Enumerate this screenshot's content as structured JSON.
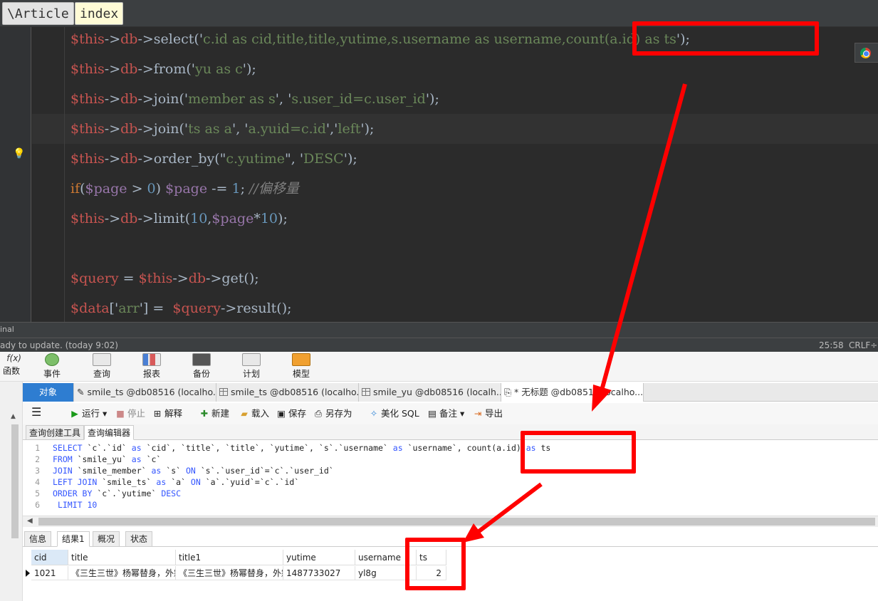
{
  "ide": {
    "breadcrumbs": [
      "\\Article",
      "index"
    ],
    "code_lines": [
      [
        [
          "v",
          "$this"
        ],
        [
          "p",
          "->"
        ],
        [
          "v",
          "db"
        ],
        [
          "p",
          "->select('"
        ],
        [
          "s",
          "c.id as cid,title,title,yutime,s.username as username,count(a.id) as ts"
        ],
        [
          "p",
          "');"
        ]
      ],
      [
        [
          "v",
          "$this"
        ],
        [
          "p",
          "->"
        ],
        [
          "v",
          "db"
        ],
        [
          "p",
          "->from('"
        ],
        [
          "s",
          "yu as c"
        ],
        [
          "p",
          "');"
        ]
      ],
      [
        [
          "v",
          "$this"
        ],
        [
          "p",
          "->"
        ],
        [
          "v",
          "db"
        ],
        [
          "p",
          "->join('"
        ],
        [
          "s",
          "member as s"
        ],
        [
          "p",
          "', '"
        ],
        [
          "s",
          "s.user_id=c.user_id"
        ],
        [
          "p",
          "');"
        ]
      ],
      [
        [
          "v",
          "$this"
        ],
        [
          "p",
          "->"
        ],
        [
          "v",
          "db"
        ],
        [
          "p",
          "->join('"
        ],
        [
          "s",
          "ts as a"
        ],
        [
          "p",
          "', '"
        ],
        [
          "s",
          "a.yuid=c.id"
        ],
        [
          "p",
          "','"
        ],
        [
          "s",
          "left"
        ],
        [
          "p",
          "');"
        ]
      ],
      [
        [
          "v",
          "$this"
        ],
        [
          "p",
          "->"
        ],
        [
          "v",
          "db"
        ],
        [
          "p",
          "->order_by(\""
        ],
        [
          "s",
          "c.yutime"
        ],
        [
          "p",
          "\", '"
        ],
        [
          "s",
          "DESC"
        ],
        [
          "p",
          "');"
        ]
      ],
      [
        [
          "kw",
          "if"
        ],
        [
          "p",
          "("
        ],
        [
          "pv",
          "$page"
        ],
        [
          "p",
          " > "
        ],
        [
          "n",
          "0"
        ],
        [
          "p",
          ") "
        ],
        [
          "pv",
          "$page"
        ],
        [
          "p",
          " -= "
        ],
        [
          "n",
          "1"
        ],
        [
          "p",
          "; "
        ],
        [
          "cm",
          "//偏移量"
        ]
      ],
      [
        [
          "v",
          "$this"
        ],
        [
          "p",
          "->"
        ],
        [
          "v",
          "db"
        ],
        [
          "p",
          "->limit("
        ],
        [
          "n",
          "10"
        ],
        [
          "p",
          ","
        ],
        [
          "pv",
          "$page"
        ],
        [
          "p",
          "*"
        ],
        [
          "n",
          "10"
        ],
        [
          "p",
          ");"
        ]
      ],
      [],
      [
        [
          "v",
          "$query"
        ],
        [
          "p",
          " = "
        ],
        [
          "v",
          "$this"
        ],
        [
          "p",
          "->"
        ],
        [
          "v",
          "db"
        ],
        [
          "p",
          "->get();"
        ]
      ],
      [
        [
          "v",
          "$data"
        ],
        [
          "p",
          "['"
        ],
        [
          "s",
          "arr"
        ],
        [
          "p",
          "'] =  "
        ],
        [
          "v",
          "$query"
        ],
        [
          "p",
          "->result();"
        ]
      ]
    ],
    "terminal_label": "inal",
    "status_message": "ady to update. (today 9:02)",
    "cursor_position": "25:58",
    "line_ending": "CRLF÷"
  },
  "navicat": {
    "main_toolbar": [
      "函数",
      "事件",
      "查询",
      "报表",
      "备份",
      "计划",
      "模型"
    ],
    "function_icon_label": "f(x)",
    "doc_tabs": [
      {
        "label": "对象",
        "kind": "objects"
      },
      {
        "label": "smile_ts @db08516 (localho...",
        "kind": "design"
      },
      {
        "label": "smile_ts @db08516 (localho...",
        "kind": "table"
      },
      {
        "label": "smile_yu @db08516 (localh...",
        "kind": "table"
      },
      {
        "label": "* 无标题 @db08516(localho...",
        "kind": "query"
      }
    ],
    "query_toolbar": {
      "menu": "☰",
      "run": "运行",
      "stop": "停止",
      "explain": "解释",
      "new": "新建",
      "load": "载入",
      "save": "保存",
      "save_as": "另存为",
      "beautify": "美化 SQL",
      "comment": "备注",
      "export": "导出"
    },
    "sub_tabs": [
      "查询创建工具",
      "查询编辑器"
    ],
    "sql_lines": [
      [
        [
          "sp",
          "SELECT"
        ],
        [
          "t",
          " `c`.`id` "
        ],
        [
          "sp",
          "as"
        ],
        [
          "t",
          " `cid`, `title`, `title`, `yutime`, `s`.`username` "
        ],
        [
          "sp",
          "as"
        ],
        [
          "t",
          " `username`, count(a.id) "
        ],
        [
          "sp",
          "as"
        ],
        [
          "t",
          " ts"
        ]
      ],
      [
        [
          "sp",
          "FROM"
        ],
        [
          "t",
          " `smile_yu` "
        ],
        [
          "sp",
          "as"
        ],
        [
          "t",
          " `c`"
        ]
      ],
      [
        [
          "sp",
          "JOIN"
        ],
        [
          "t",
          " `smile_member` "
        ],
        [
          "sp",
          "as"
        ],
        [
          "t",
          " `s` "
        ],
        [
          "sp",
          "ON"
        ],
        [
          "t",
          " `s`.`user_id`=`c`.`user_id`"
        ]
      ],
      [
        [
          "sp",
          "LEFT JOIN"
        ],
        [
          "t",
          " `smile_ts` "
        ],
        [
          "sp",
          "as"
        ],
        [
          "t",
          " `a` "
        ],
        [
          "sp",
          "ON"
        ],
        [
          "t",
          " `a`.`yuid`=`c`.`id`"
        ]
      ],
      [
        [
          "sp",
          "ORDER BY"
        ],
        [
          "t",
          " `c`.`yutime` "
        ],
        [
          "sp",
          "DESC"
        ]
      ],
      [
        [
          "t",
          " "
        ],
        [
          "sp",
          "LIMIT"
        ],
        [
          "t",
          " "
        ],
        [
          "sp",
          "10"
        ]
      ]
    ],
    "result_tabs": [
      "信息",
      "结果1",
      "概况",
      "状态"
    ],
    "grid": {
      "columns": [
        "cid",
        "title",
        "title1",
        "yutime",
        "username",
        "ts"
      ],
      "rows": [
        [
          "1021",
          "《三生三世》杨幂替身，外籍",
          "《三生三世》杨幂替身，外籍",
          "1487733027",
          "yl8g",
          "2"
        ]
      ]
    }
  },
  "colors": {
    "annotation": "#ff0000",
    "ide_bg": "#2b2b2b",
    "php_variable": "#c75450",
    "php_string": "#6a8759",
    "sql_keyword": "#3355ff",
    "object_tab": "#2e7dd1"
  }
}
